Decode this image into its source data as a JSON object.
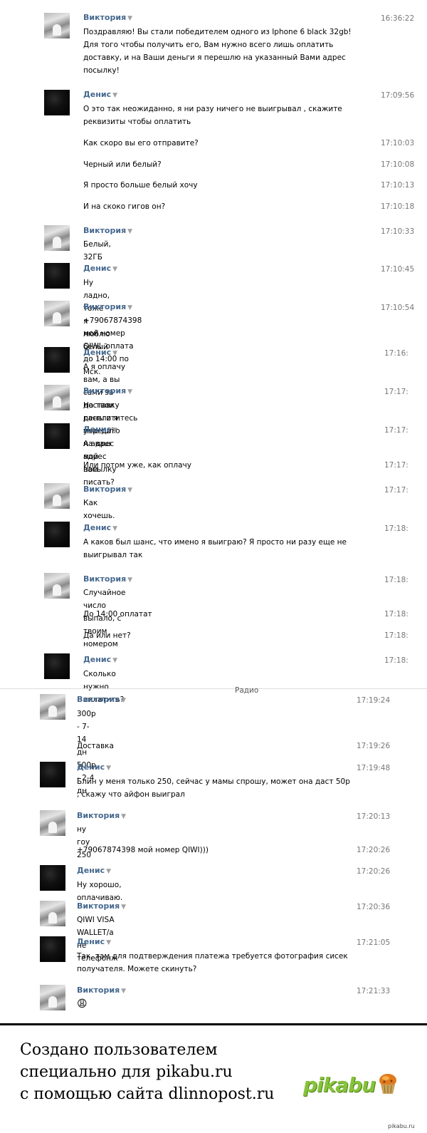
{
  "chat": {
    "messages": [
      {
        "author": "Виктория",
        "time": "16:36:22",
        "text": "Поздравляю! Вы стали победителем одного из Iphone 6 black 32gb! Для того чтобы получить его, Вам нужно всего лишь оплатить доставку, и на Ваши деньги я перешлю на указанный Вами адрес посылку!"
      },
      {
        "author": "Денис",
        "time": "17:09:56",
        "text": "О это так неожиданно, я ни разу ничего не выигрывал , скажите реквизиты чтобы оплатить"
      },
      {
        "time": "17:10:03",
        "text": "Как скоро вы его отправите?"
      },
      {
        "time": "17:10:08",
        "text": "Черный или белый?"
      },
      {
        "time": "17:10:13",
        "text": "Я просто больше белый хочу"
      },
      {
        "time": "17:10:18",
        "text": "И на скоко гигов он?"
      },
      {
        "author": "Виктория",
        "time": "17:10:33",
        "text": "Белый, 32ГБ"
      },
      {
        "author": "Денис",
        "time": "17:10:45",
        "text": "Ну ладно, тоже я люблю белый"
      },
      {
        "author": "Виктория",
        "time": "17:10:54",
        "text": "+79067874398 мой номер QIWI, оплата до 14:00 по Мск."
      },
      {
        "author": "Денис",
        "time": "17:16:",
        "text": "А я оплачу вам, а вы сами за доставку расплотитесь уже да?"
      },
      {
        "author": "Виктория",
        "time": "17:17:",
        "text": "На твои деньги я перешлю на ваш адрес посылку"
      },
      {
        "author": "Денис",
        "time": "17:17:",
        "text": "А адрес мой вам писать?"
      },
      {
        "time": "17:17:",
        "text": "Или потом уже, как оплачу"
      },
      {
        "author": "Виктория",
        "time": "17:17:",
        "text": "Как хочешь."
      },
      {
        "author": "Денис",
        "time": "17:18:",
        "text": "А каков был шанс, что имено я выиграю? Я просто ни разу еще не выигрывал так"
      },
      {
        "author": "Виктория",
        "time": "17:18:",
        "text": "Случайное число выпало, с твоим номером"
      },
      {
        "time": "17:18:",
        "text": "До 14:00 оплатат"
      },
      {
        "time": "17:18:",
        "text": "Да или нет?"
      },
      {
        "author": "Денис",
        "time": "17:18:",
        "text": "Сколько нужно оплатить?"
      }
    ],
    "radio_label": "Радио",
    "messages2": [
      {
        "author": "Виктория",
        "time": "17:19:24",
        "text": "300р - 7-14 дн\n500р - 2-4 дн"
      },
      {
        "time": "17:19:26",
        "text": "Доставка"
      },
      {
        "author": "Денис",
        "time": "17:19:48",
        "text": "Блин у меня только 250, сейчас у мамы спрошу, может она даст 50р , скажу что айфон выиграл"
      },
      {
        "author": "Виктория",
        "time": "17:20:13",
        "text": "ну гоу 250"
      },
      {
        "time": "17:20:26",
        "text": "+79067874398 мой номер QIWI)))"
      },
      {
        "author": "Денис",
        "time": "17:20:26",
        "text": "Ну хорошо, оплачиваю."
      },
      {
        "author": "Виктория",
        "time": "17:20:36",
        "text": "QIWI VISA WALLET/а не телефонж"
      },
      {
        "author": "Денис",
        "time": "17:21:05",
        "text": "Так, там для подтверждения платежа требуется фотография сисек получателя. Можете скинуть?"
      },
      {
        "author": "Виктория",
        "time": "17:21:33",
        "text": "😩"
      }
    ]
  },
  "footer": {
    "line1": "Создано пользователем",
    "line2": "специально для pikabu.ru",
    "line3": "с помощью сайта dlinnopost.ru",
    "logo": "pikabu",
    "watermark": "pikabu.ru"
  },
  "colors": {
    "name": "#45688e",
    "time": "#777777",
    "logo": "#86c33a"
  },
  "icons": {
    "dropdown": "triangle-down-icon",
    "muffin": "muffin-logo-icon"
  }
}
